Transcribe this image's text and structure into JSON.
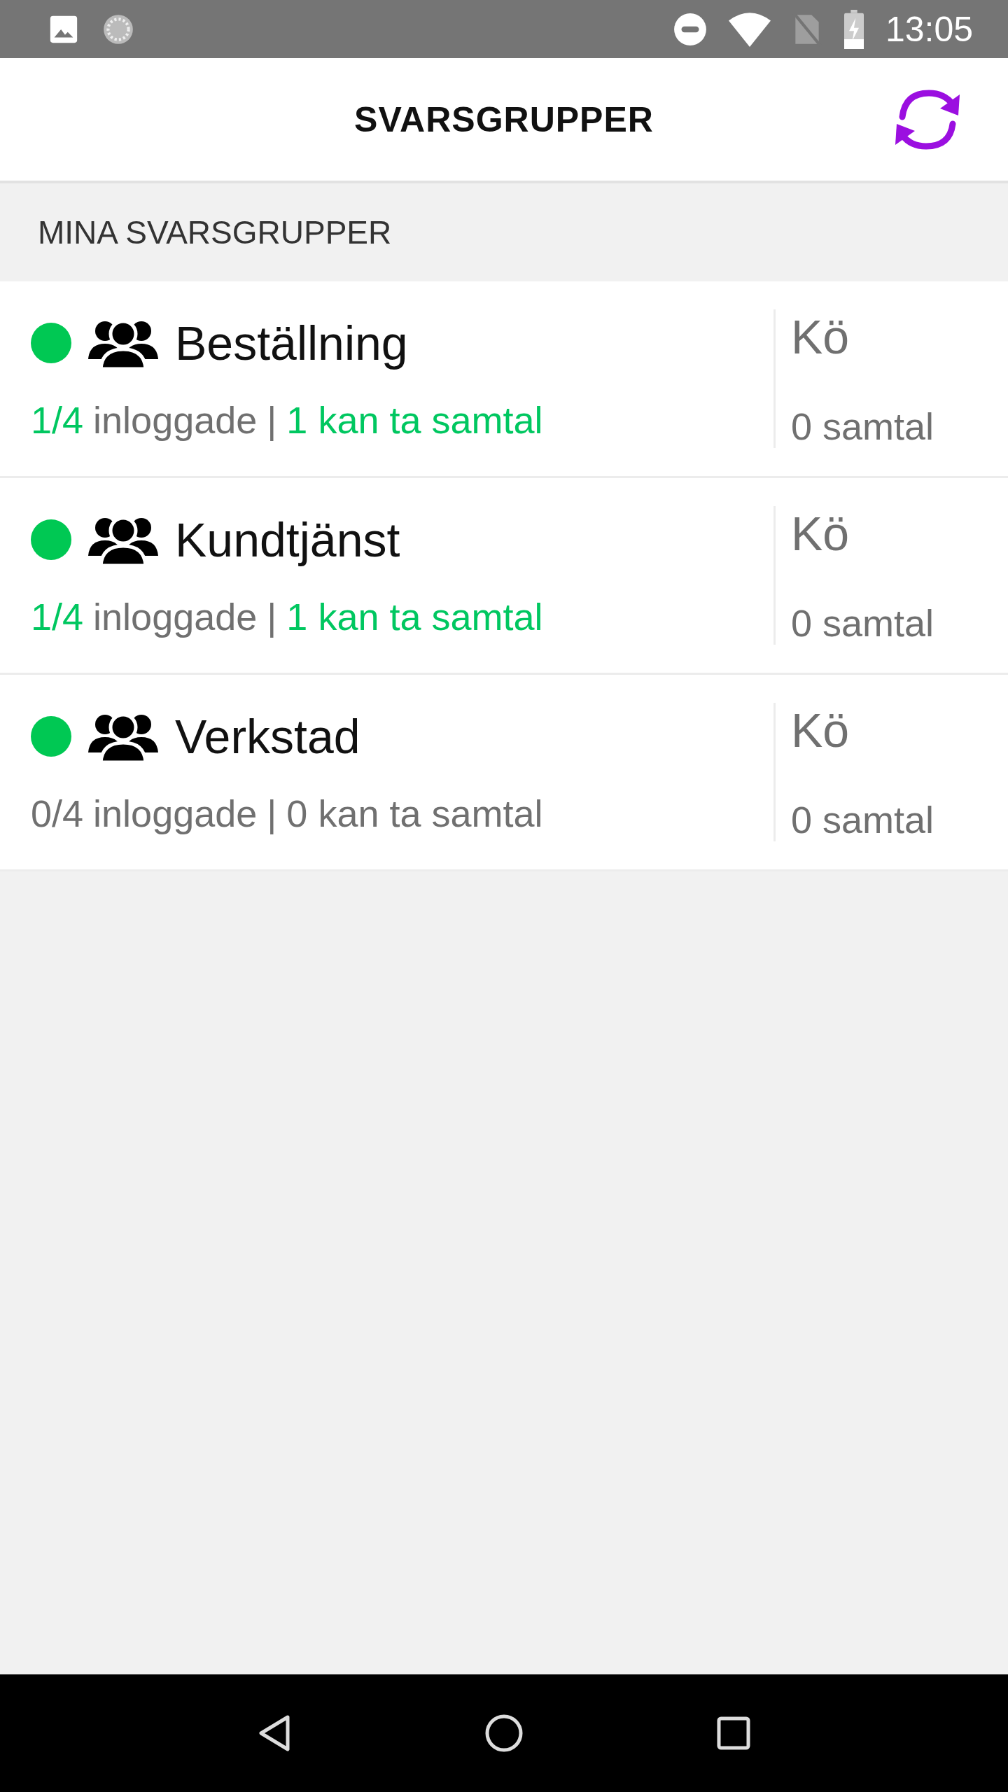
{
  "status_bar": {
    "time": "13:05"
  },
  "header": {
    "title": "SVARSGRUPPER"
  },
  "section": {
    "title": "MINA SVARSGRUPPER"
  },
  "groups": [
    {
      "name": "Beställning",
      "color": "#00c853",
      "logged_in": "1/4",
      "logged_in_label": "inloggade",
      "separator": "|",
      "available": "1 kan ta samtal",
      "highlighted": true,
      "queue_label": "Kö",
      "queue": "0 samtal"
    },
    {
      "name": "Kundtjänst",
      "color": "#00c853",
      "logged_in": "1/4",
      "logged_in_label": "inloggade",
      "separator": "|",
      "available": "1 kan ta samtal",
      "highlighted": true,
      "queue_label": "Kö",
      "queue": "0 samtal"
    },
    {
      "name": "Verkstad",
      "color": "#00c853",
      "logged_in": "0/4",
      "logged_in_label": "inloggade",
      "separator": "|",
      "available": "0 kan ta samtal",
      "highlighted": false,
      "queue_label": "Kö",
      "queue": "0 samtal"
    }
  ]
}
